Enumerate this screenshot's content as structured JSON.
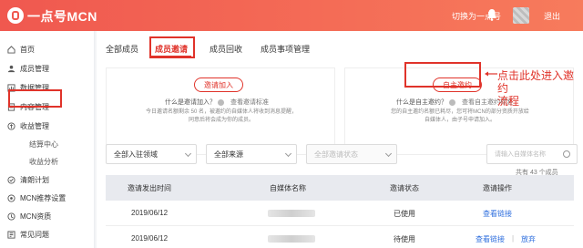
{
  "header": {
    "logo_text": "一点号MCN",
    "switch_label": "切换为一点号",
    "logout_label": "退出"
  },
  "sidebar": {
    "items": [
      {
        "label": "首页",
        "icon": "home-icon"
      },
      {
        "label": "成员管理",
        "icon": "person-icon"
      },
      {
        "label": "数据管理",
        "icon": "data-icon"
      },
      {
        "label": "内容管理",
        "icon": "content-icon"
      },
      {
        "label": "收益管理",
        "icon": "coin-icon"
      },
      {
        "label": "结算中心"
      },
      {
        "label": "收益分析"
      },
      {
        "label": "清朗计划",
        "icon": "clear-plan-icon"
      },
      {
        "label": "MCN推荐设置",
        "icon": "recommend-icon"
      },
      {
        "label": "MCN资质",
        "icon": "qualification-icon"
      },
      {
        "label": "常见问题",
        "icon": "faq-icon"
      }
    ]
  },
  "tabs": [
    {
      "label": "全部成员"
    },
    {
      "label": "成员邀请"
    },
    {
      "label": "成员回收"
    },
    {
      "label": "成员事项管理"
    }
  ],
  "cards": {
    "invite": {
      "button": "邀请加入",
      "question": "什么是邀请加入？",
      "link": "查看邀请标准",
      "desc_line1": "今日邀请名额剩余 50 名，被邀约的自媒体人将收到消息提醒，",
      "desc_line2": "同意后将会成为你的成员。"
    },
    "self": {
      "button": "自主邀约",
      "question": "什么是自主邀约？",
      "link": "查看自主邀约标准",
      "desc_line1": "您的自主邀约名额已耗尽，您可将MCN的部分资质开放给",
      "desc_line2": "自媒体人，由子号申请加入。"
    }
  },
  "annotation": {
    "line1": "点击此处进入邀约",
    "line2": "流程"
  },
  "filters": {
    "domain": "全部入驻领域",
    "source": "全部来源",
    "status": "全部邀请状态",
    "search_placeholder": "请输入自媒体名称"
  },
  "count_text": "共有 43 个成员",
  "table": {
    "headers": [
      "邀请发出时间",
      "自媒体名称",
      "邀请状态",
      "邀请操作"
    ],
    "rows": [
      {
        "date": "2019/06/12",
        "status": "已使用",
        "actions": [
          "查看链接"
        ]
      },
      {
        "date": "2019/06/12",
        "status": "待使用",
        "actions": [
          "查看链接",
          "|",
          "放弃"
        ]
      }
    ]
  },
  "colors": {
    "accent": "#e0332a",
    "header_gradient_start": "#f0584f",
    "header_gradient_end": "#f77b5c",
    "link": "#2f6fde"
  }
}
